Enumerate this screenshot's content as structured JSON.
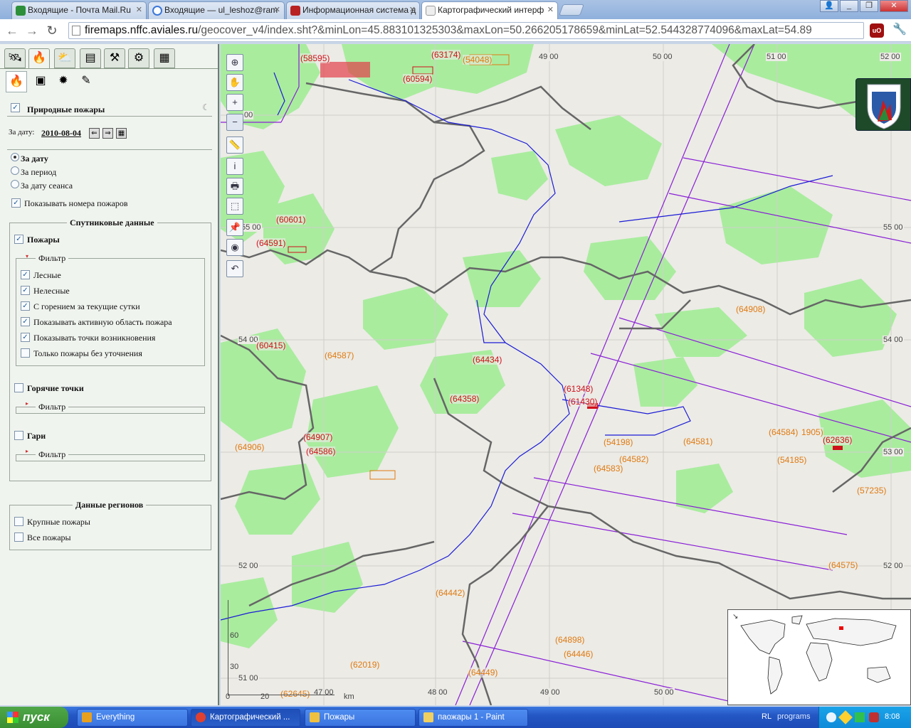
{
  "browser": {
    "tabs": [
      {
        "title": "Входящие - Почта Mail.Ru",
        "fav_color": "#2d8f3a"
      },
      {
        "title": "Входящие — ul_leshoz@ram",
        "fav_color": "#3b77d8"
      },
      {
        "title": "Информационная система д",
        "fav_color": "#b82222"
      },
      {
        "title": "Картографический интерф",
        "fav_color": "#eeeeee"
      }
    ],
    "url_domain": "firemaps.nffc.aviales.ru",
    "url_path": "/geocover_v4/index.sht?&minLon=45.883101325303&maxLon=50.266205178659&minLat=52.544328774096&maxLat=54.89"
  },
  "panel": {
    "main_tabs": [
      "satellite-icon",
      "fire-icon",
      "weather-icon",
      "layers-icon",
      "tools-icon",
      "gear-icon",
      "table-icon"
    ],
    "sub_tabs": [
      "fire-icon",
      "database-icon",
      "burn-icon",
      "pencil-icon"
    ],
    "natural_fires_label": "Природные пожары",
    "date_label": "За дату:",
    "date_value": "2010-08-04",
    "radio_date": "За дату",
    "radio_period": "За период",
    "radio_session": "За дату сеанса",
    "show_numbers": "Показывать номера пожаров",
    "satellite_legend": "Спутниковые данные",
    "fires_label": "Пожары",
    "filter_label": "Фильтр",
    "filters": {
      "forest": "Лесные",
      "nonforest": "Нелесные",
      "burning_today": "С горением за текущие сутки",
      "active_area": "Показывать активную область пожара",
      "origin_points": "Показывать точки возникновения",
      "unverified_only": "Только пожары без уточнения"
    },
    "hotspots_label": "Горячие точки",
    "burns_label": "Гари",
    "regions_legend": "Данные регионов",
    "large_fires": "Крупные пожары",
    "all_fires": "Все пожары"
  },
  "map": {
    "coords": {
      "lon49_top": "49 00",
      "lon50_top": "50 00",
      "lon51_top": "51 00",
      "lon52_top": "52 00",
      "lat55_right": "55 00",
      "lat54_right": "54 00",
      "lat53_right": "53 00",
      "lat52_right": "52 00",
      "lat55_left": "55 00",
      "lat54_left": "54 00",
      "lat52_left": "52 00",
      "lat51_left": "51 00",
      "lon48_bottom": "48 00",
      "lon49_bottom": "49 00",
      "lon50_bottom": "50 00",
      "lat_top_left": "00"
    },
    "fires_red": {
      "f58595": "(58595)",
      "f63174": "(63174)",
      "f60594": "(60594)",
      "f60601": "(60601)",
      "f64591": "(64591)",
      "f60415": "(60415)",
      "f64434": "(64434)",
      "f64358": "(64358)",
      "f61348": "(61348)",
      "f61430": "(61430)",
      "f64907": "(64907)",
      "f64586": "(64586)",
      "f62636": "(62636)"
    },
    "fires_orange": {
      "f54048": "(54048)",
      "f64908": "(64908)",
      "f64587": "(64587)",
      "f64906": "(64906)",
      "f54198": "(54198)",
      "f64583": "(64583)",
      "f64582": "(64582)",
      "f64581": "(64581)",
      "f64584": "(64584)",
      "f61905": "1905)",
      "f54185": "(54185)",
      "f57235": "(57235)",
      "f64575": "(64575)",
      "f64442": "(64442)",
      "f64898": "(64898)",
      "f64446": "(64446)",
      "f62019": "(62019)",
      "f64449": "(64449)",
      "f62645": "(62645)"
    },
    "scale": {
      "v60": "60",
      "v30": "30",
      "v0": "0",
      "v20": "20",
      "v47": "47 00",
      "km": "km"
    }
  },
  "taskbar": {
    "start": "пуск",
    "tasks": [
      {
        "label": "Everything",
        "color": "#e8a020"
      },
      {
        "label": "Картографический ...",
        "color": "#e04030"
      },
      {
        "label": "Пожары",
        "color": "#f0c040"
      },
      {
        "label": "паожары 1 - Paint",
        "color": "#f0d060"
      }
    ],
    "lang": "RL",
    "programs": "programs",
    "time": "8:08"
  }
}
